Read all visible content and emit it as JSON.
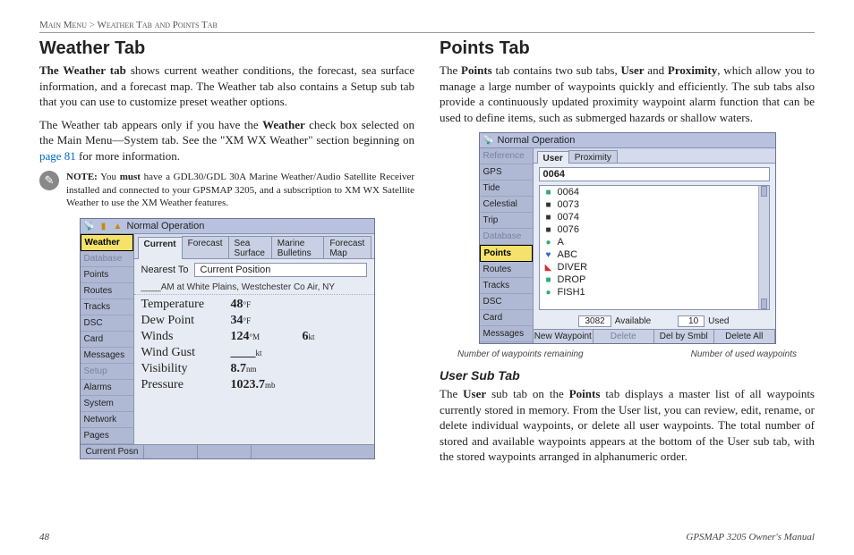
{
  "breadcrumb": {
    "root": "Main Menu",
    "sep": ">",
    "page": "Weather Tab and Points Tab"
  },
  "left": {
    "heading": "Weather Tab",
    "p1_a": "The Weather tab",
    "p1_b": " shows current weather conditions, the forecast, sea surface information, and a forecast map. The Weather tab also contains a Setup sub tab that you can use to customize preset weather options.",
    "p2_a": "The Weather tab appears only if you have the ",
    "p2_b": "Weather",
    "p2_c": " check box selected on the Main Menu—System tab. See the \"XM WX Weather\" section beginning on ",
    "p2_link": "page 81",
    "p2_d": " for more information.",
    "note_label": "NOTE:",
    "note_a": " You ",
    "note_b": "must",
    "note_c": " have a GDL30/GDL 30A Marine Weather/Audio Satellite Receiver installed and connected to your GPSMAP 3205, and a subscription to XM WX Satellite Weather to use the XM Weather features."
  },
  "right": {
    "heading": "Points Tab",
    "p1_a": "The ",
    "p1_b": "Points",
    "p1_c": " tab contains two sub tabs, ",
    "p1_d": "User",
    "p1_e": " and ",
    "p1_f": "Proximity",
    "p1_g": ", which allow you to manage a large number of waypoints quickly and efficiently. The sub tabs also provide a continuously updated proximity waypoint alarm function that can be used to define items, such as submerged hazards or shallow waters.",
    "sub_heading": "User Sub Tab",
    "p2_a": "The ",
    "p2_b": "User",
    "p2_c": " sub tab on the ",
    "p2_d": "Points",
    "p2_e": " tab displays a master list of all waypoints currently stored in memory. From the User list, you can review, edit, rename, or delete individual waypoints, or delete all user waypoints. The total number of stored and available waypoints appears at the bottom of the User sub tab, with the stored waypoints arranged in alphanumeric order."
  },
  "device_weather": {
    "title": "Normal Operation",
    "side": [
      "Weather",
      "Database",
      "Points",
      "Routes",
      "Tracks",
      "DSC",
      "Card",
      "Messages",
      "Setup",
      "Alarms",
      "System",
      "Network",
      "Pages"
    ],
    "side_sel": 0,
    "side_dim": [
      1,
      8
    ],
    "tabs": [
      "Current",
      "Forecast",
      "Sea Surface",
      "Marine Bulletins",
      "Forecast Map"
    ],
    "tab_sel": 0,
    "nearest_label": "Nearest To",
    "nearest_value": "Current Position",
    "info": "____AM at White Plains, Westchester Co Air, NY",
    "rows": [
      {
        "label": "Temperature",
        "val": "48",
        "unit": "°F",
        "val2": "",
        "unit2": ""
      },
      {
        "label": "Dew Point",
        "val": "34",
        "unit": "°F",
        "val2": "",
        "unit2": ""
      },
      {
        "label": "Winds",
        "val": "124",
        "unit": "°M",
        "val2": "6",
        "unit2": "kt"
      },
      {
        "label": "Wind Gust",
        "val": "____",
        "unit": "kt",
        "val2": "",
        "unit2": ""
      },
      {
        "label": "Visibility",
        "val": "8.7",
        "unit": "nm",
        "val2": "",
        "unit2": ""
      },
      {
        "label": "Pressure",
        "val": "1023.7",
        "unit": "mb",
        "val2": "",
        "unit2": ""
      }
    ],
    "status": "Current Posn"
  },
  "device_points": {
    "title": "Normal Operation",
    "side": [
      "Reference",
      "GPS",
      "Tide",
      "Celestial",
      "Trip",
      "Database",
      "Points",
      "Routes",
      "Tracks",
      "DSC",
      "Card",
      "Messages"
    ],
    "side_sel": 6,
    "side_dim": [
      0,
      5
    ],
    "tabs": [
      "User",
      "Proximity"
    ],
    "tab_sel": 0,
    "header_value": "0064",
    "items": [
      {
        "sym": "■",
        "color": "#3a7",
        "name": "0064"
      },
      {
        "sym": "■",
        "color": "#333",
        "name": "0073"
      },
      {
        "sym": "■",
        "color": "#333",
        "name": "0074"
      },
      {
        "sym": "■",
        "color": "#333",
        "name": "0076"
      },
      {
        "sym": "●",
        "color": "#3a7",
        "name": "A"
      },
      {
        "sym": "♥",
        "color": "#36c",
        "name": "ABC"
      },
      {
        "sym": "◣",
        "color": "#c33",
        "name": "DIVER"
      },
      {
        "sym": "■",
        "color": "#3a7",
        "name": "DROP"
      },
      {
        "sym": "●",
        "color": "#3a7",
        "name": "FISH1"
      }
    ],
    "available_num": "3082",
    "available_label": "Available",
    "used_num": "10",
    "used_label": "Used",
    "buttons": [
      "New Waypoint",
      "Delete",
      "Del by Smbl",
      "Delete All"
    ],
    "buttons_dim": [
      1
    ],
    "caption_left": "Number of waypoints remaining",
    "caption_right": "Number of used waypoints"
  },
  "footer": {
    "page": "48",
    "manual": "GPSMAP 3205 Owner's Manual"
  }
}
